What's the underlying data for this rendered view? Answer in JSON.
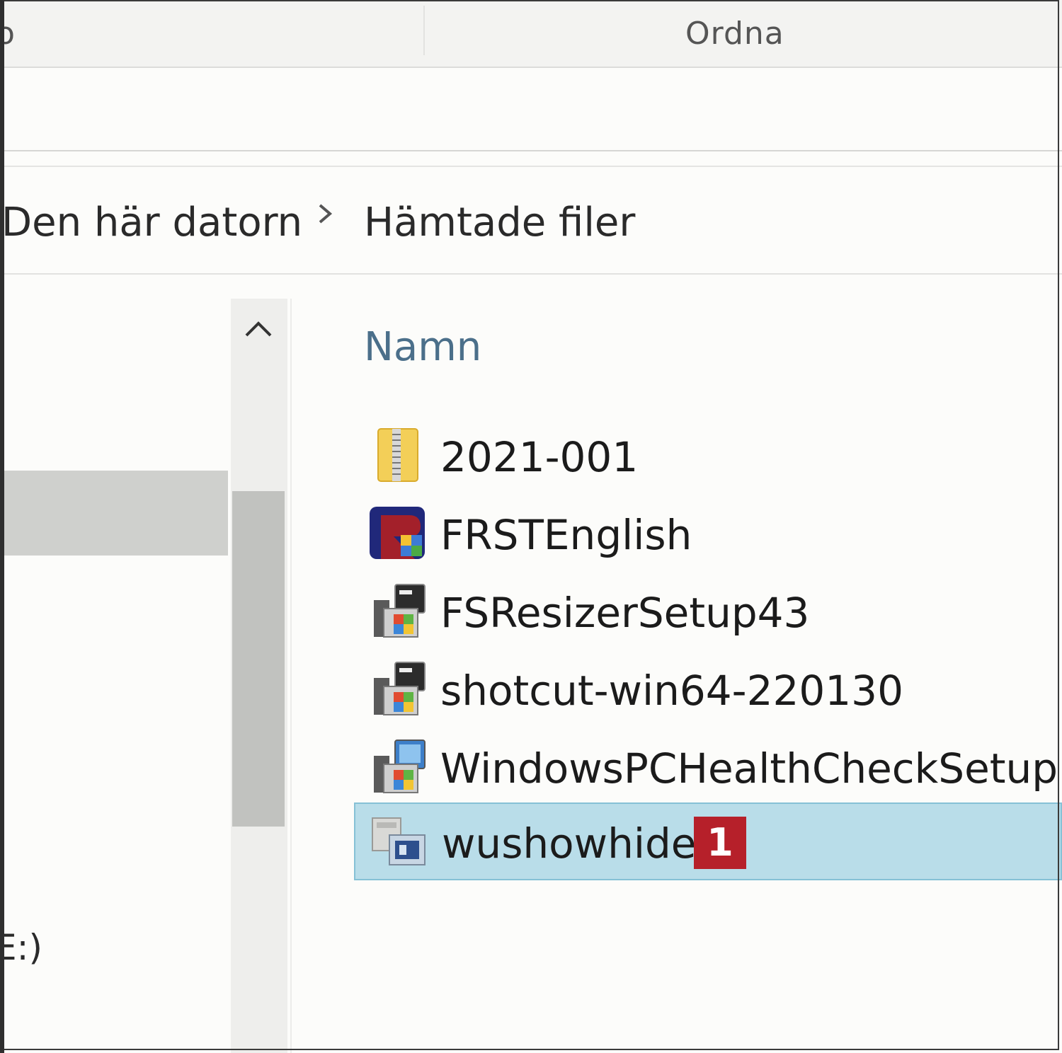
{
  "ribbon": {
    "partial_tab": "o",
    "tab_ordna": "Ordna"
  },
  "breadcrumb": {
    "items": [
      "Den här datorn",
      "Hämtade filer"
    ]
  },
  "nav": {
    "drive_label_partial": "E:)"
  },
  "file_list": {
    "column_name": "Namn",
    "files": [
      {
        "name": "2021-001",
        "icon": "zip-folder-icon"
      },
      {
        "name": "FRSTEnglish",
        "icon": "frst-app-icon"
      },
      {
        "name": "FSResizerSetup43",
        "icon": "installer-icon"
      },
      {
        "name": "shotcut-win64-220130",
        "icon": "installer-icon"
      },
      {
        "name": "WindowsPCHealthCheckSetup",
        "icon": "msi-installer-icon"
      },
      {
        "name": "wushowhide",
        "icon": "diagcab-icon",
        "selected": true,
        "badge": "1"
      }
    ]
  },
  "colors": {
    "selection": "#b9dde9",
    "selection_border": "#86c1d6",
    "badge": "#b6202a",
    "column_header": "#4b6f8a"
  }
}
